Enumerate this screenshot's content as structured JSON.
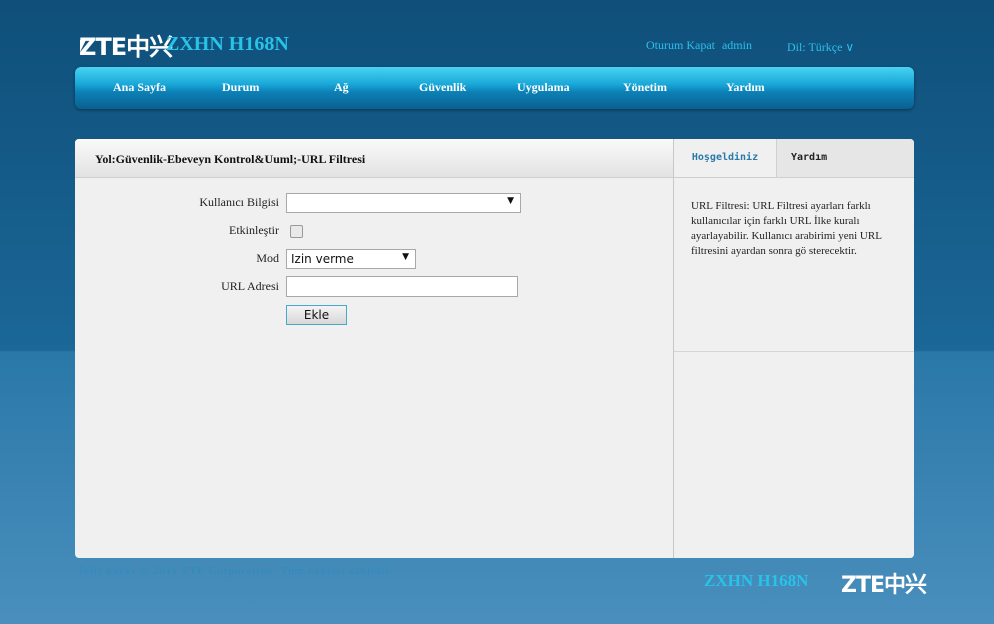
{
  "header": {
    "logo": "ZTE中兴",
    "model": "ZXHN H168N",
    "logout": "Oturum Kapat",
    "user": "admin",
    "language": "Dil: Türkçe ∨"
  },
  "nav": {
    "items": [
      "Ana Sayfa",
      "Durum",
      "Ağ",
      "Güvenlik",
      "Uygulama",
      "Yönetim",
      "Yardım"
    ]
  },
  "breadcrumb": "Yol:Güvenlik-Ebeveyn Kontrol&Uuml;-URL Filtresi",
  "form": {
    "user_info_label": "Kullanıcı Bilgisi",
    "user_info_value": "",
    "enable_label": "Etkinleştir",
    "enable_checked": false,
    "mode_label": "Mod",
    "mode_value": "Izin verme",
    "url_label": "URL Adresi",
    "url_value": "",
    "add_button": "Ekle"
  },
  "side": {
    "tab_welcome": "Hoşgeldiniz",
    "tab_help": "Yardım",
    "help_text": "URL Filtresi: URL Filtresi ayarları farklı kullanıcılar için farklı URL İlke kuralı ayarlayabilir. Kullanıcı arabirimi yeni URL filtresini ayardan sonra gö sterecektir."
  },
  "footer": {
    "copyright": "Telif hakkı © 2011 ZTE Corporation. Tüm hakları saklıdır.",
    "model": "ZXHN H168N",
    "logo": "ZTE中兴"
  },
  "colors": {
    "accent": "#28c3e8",
    "nav": "#1aa9d9",
    "background": "#1b6797"
  }
}
